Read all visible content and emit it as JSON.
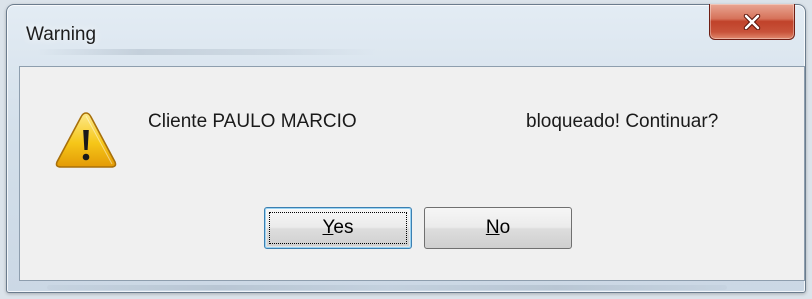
{
  "window": {
    "title": "Warning"
  },
  "dialog": {
    "message_left": "Cliente PAULO MARCIO",
    "message_right": "bloqueado! Continuar?",
    "icon": "warning-triangle-icon"
  },
  "buttons": {
    "yes": {
      "accel": "Y",
      "rest": "es"
    },
    "no": {
      "accel": "N",
      "rest": "o"
    }
  },
  "colors": {
    "close_button": "#c8533a",
    "warning_yellow": "#f6c719",
    "default_button_border": "#3c7fb1"
  }
}
